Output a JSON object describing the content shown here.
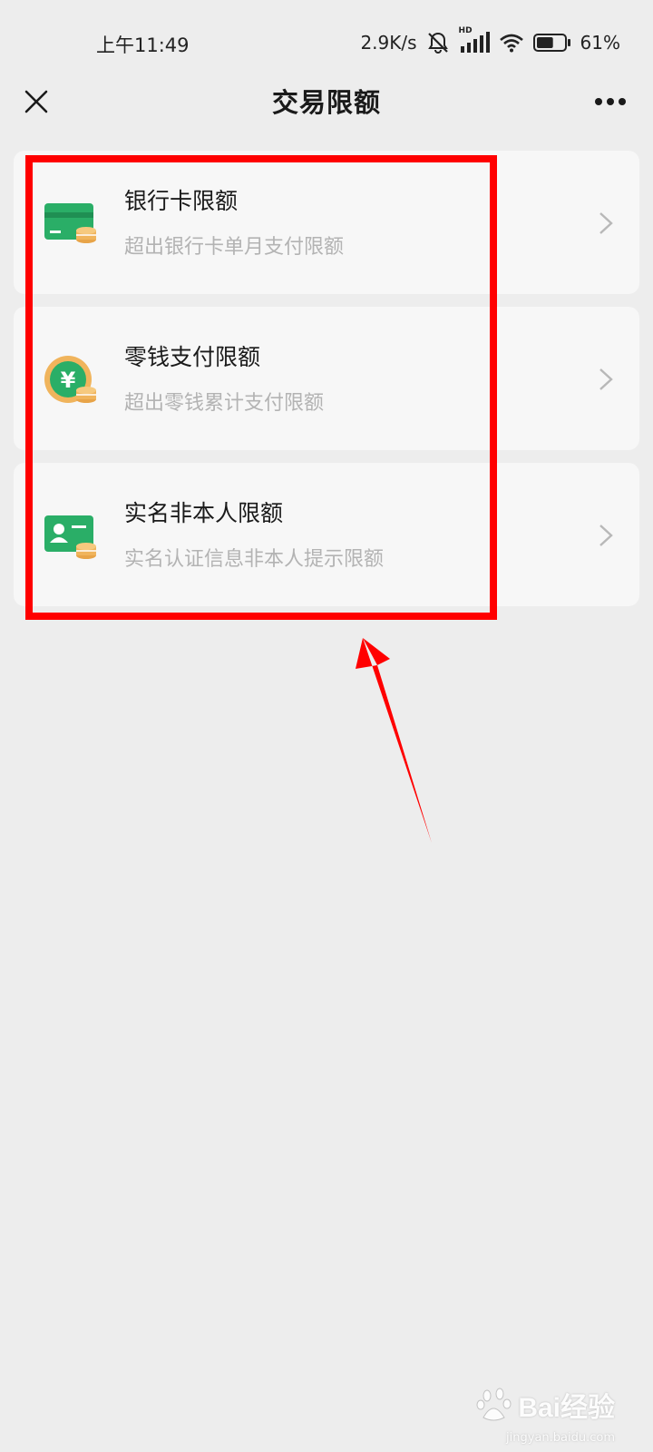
{
  "status_bar": {
    "time": "上午11:49",
    "network_speed": "2.9K/s",
    "signal_badge": "HD",
    "battery_percent": "61%",
    "battery_level": 0.61,
    "icons": [
      "mute-bell-icon",
      "signal-icon",
      "wifi-icon",
      "battery-icon"
    ]
  },
  "header": {
    "title": "交易限额",
    "close_icon": "close-icon",
    "more_icon": "more-dots-icon"
  },
  "items": [
    {
      "title": "银行卡限额",
      "subtitle": "超出银行卡单月支付限额",
      "icon": "bank-card-coins-icon"
    },
    {
      "title": "零钱支付限额",
      "subtitle": "超出零钱累计支付限额",
      "icon": "yuan-coin-icon"
    },
    {
      "title": "实名非本人限额",
      "subtitle": "实名认证信息非本人提示限额",
      "icon": "id-card-coins-icon"
    }
  ],
  "colors": {
    "background": "#ededed",
    "card": "#f7f7f7",
    "icon_green": "#2aae67",
    "icon_gold": "#f0b45c",
    "annotation_red": "#ff0000"
  },
  "watermark": {
    "brand": "Bai经验",
    "url": "jingyan.baidu.com"
  }
}
